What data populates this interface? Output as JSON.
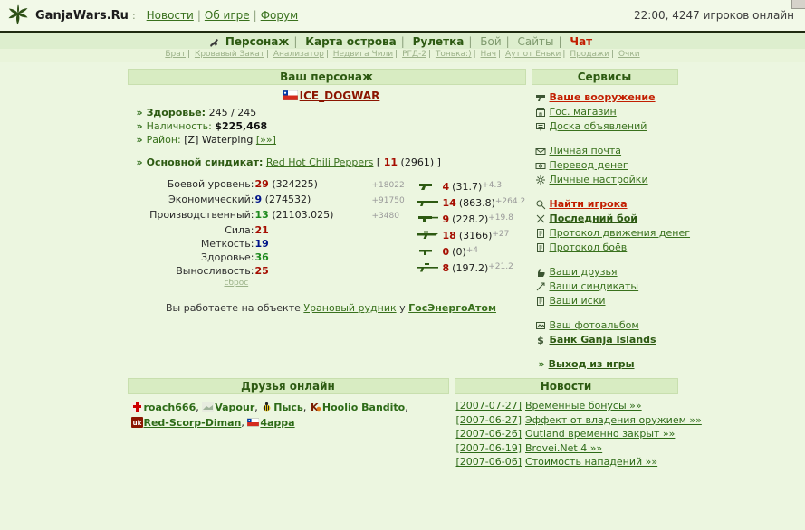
{
  "topbar": {
    "site": "GanjaWars.Ru",
    "colon": ":",
    "links": [
      "Новости",
      "Об игре",
      "Форум"
    ],
    "status": "22:00, 4247 игроков онлайн"
  },
  "nav": {
    "items": [
      "Персонаж",
      "Карта острова",
      "Рулетка",
      "Бой",
      "Сайты",
      "Чат"
    ]
  },
  "subnav": {
    "items": [
      "Брат",
      "Кровавый Закат",
      "Анализатор",
      "Недвига Чили",
      "РГД-2",
      "Тонька:)",
      "Нач",
      "Аут от Еньки",
      "Продажи",
      "Очки"
    ]
  },
  "character": {
    "header": "Ваш персонаж",
    "bullet": "»",
    "name": "ICE_DOGWAR",
    "health_label": "Здоровье:",
    "health_value": "245 / 245",
    "cash_label": "Наличность:",
    "cash_value": "$225,468",
    "district_label": "Район:",
    "district_value": "[Z] Waterping",
    "district_link": "[»»]",
    "syndicate_label": "Основной синдикат:",
    "syndicate_name": "Red Hot Chili Peppers",
    "syndicate_open": "[",
    "syndicate_rank": "11",
    "syndicate_points": "(2961)",
    "syndicate_close": "]",
    "stats": [
      {
        "label": "Боевой уровень:",
        "value": "29",
        "extra": "(324225)",
        "delta": "+18022"
      },
      {
        "label": "Экономический:",
        "value": "9",
        "extra": "(274532)",
        "delta": "+91750"
      },
      {
        "label": "Производственный:",
        "value": "13",
        "extra": "(21103.025)",
        "delta": "+3480"
      },
      {
        "label": "Сила:",
        "value": "21",
        "extra": "",
        "delta": ""
      },
      {
        "label": "Меткость:",
        "value": "19",
        "extra": "",
        "delta": ""
      },
      {
        "label": "Здоровье:",
        "value": "36",
        "extra": "",
        "delta": ""
      },
      {
        "label": "Выносливость:",
        "value": "25",
        "extra": "",
        "delta": ""
      }
    ],
    "reset_link": "сброс",
    "weapons": [
      {
        "icon": "pistol-icon",
        "value": "4",
        "extra": "(31.7)",
        "delta": "+4.3"
      },
      {
        "icon": "shotgun-icon",
        "value": "14",
        "extra": "(863.8)",
        "delta": "+264.2"
      },
      {
        "icon": "smg-icon",
        "value": "9",
        "extra": "(228.2)",
        "delta": "+19.8"
      },
      {
        "icon": "rifle-icon",
        "value": "18",
        "extra": "(3166)",
        "delta": "+27"
      },
      {
        "icon": "uzi-icon",
        "value": "0",
        "extra": "(0)",
        "delta": "+4"
      },
      {
        "icon": "sniper-icon",
        "value": "8",
        "extra": "(197.2)",
        "delta": "+21.2"
      }
    ],
    "work_prefix": "Вы работаете на объекте",
    "work_object": "Урановый рудник",
    "work_connector": "у",
    "work_employer": "ГосЭнергоАтом"
  },
  "services": {
    "header": "Сервисы",
    "items": [
      {
        "label": "Ваше вооружение"
      },
      {
        "label": "Гос. магазин"
      },
      {
        "label": "Доска объявлений"
      },
      {
        "label": "Личная почта"
      },
      {
        "label": "Перевод денег"
      },
      {
        "label": "Личные настройки"
      },
      {
        "label": "Найти игрока"
      },
      {
        "label": "Последний бой"
      },
      {
        "label": "Протокол движения денег"
      },
      {
        "label": "Протокол боёв"
      },
      {
        "label": "Ваши друзья"
      },
      {
        "label": "Ваши синдикаты"
      },
      {
        "label": "Ваши иски"
      },
      {
        "label": "Ваш фотоальбом"
      },
      {
        "label": "Банк Ganja Islands"
      }
    ],
    "exit_bullet": "»",
    "exit_label": "Выход из игры"
  },
  "friends": {
    "header": "Друзья онлайн",
    "items": [
      {
        "name": "roach666"
      },
      {
        "name": "Vapour"
      },
      {
        "name": "Пысь"
      },
      {
        "name": "Hoolio Bandito"
      },
      {
        "name": "Red-Scorp-Diman"
      },
      {
        "name": "4appa"
      }
    ]
  },
  "news": {
    "header": "Новости",
    "items": [
      {
        "date": "[2007-07-27]",
        "title": "Временные бонусы »»"
      },
      {
        "date": "[2007-06-27]",
        "title": "Эффект от владения оружием »»"
      },
      {
        "date": "[2007-06-26]",
        "title": "Outland временно закрыт »»"
      },
      {
        "date": "[2007-06-19]",
        "title": "Brovei.Net 4 »»"
      },
      {
        "date": "[2007-06-06]",
        "title": "Стоимость нападений »»"
      }
    ]
  },
  "colors": {
    "accent_green": "#39711d",
    "accent_red": "#c21e00",
    "band_bg": "#d8ecc2",
    "page_bg": "#ecf6e0"
  }
}
